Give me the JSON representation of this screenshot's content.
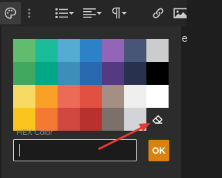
{
  "toolbar": {
    "items": [
      {
        "name": "palette-icon"
      },
      {
        "name": "more-vertical-icon"
      },
      {
        "name": "bulleted-list-icon",
        "has_dropdown": true
      },
      {
        "name": "align-left-icon",
        "has_dropdown": true
      },
      {
        "name": "paragraph-icon",
        "has_dropdown": true
      },
      {
        "name": "link-icon"
      },
      {
        "name": "image-icon"
      }
    ]
  },
  "palette": {
    "swatches": [
      [
        "#61bd6d",
        "#1abc9c",
        "#54acd2",
        "#2c82c9",
        "#9365b8",
        "#475577",
        "#cccccc"
      ],
      [
        "#41a85f",
        "#00a885",
        "#3d8eb9",
        "#2969b0",
        "#553982",
        "#28324e",
        "#000000"
      ],
      [
        "#f7da64",
        "#fba026",
        "#eb6b56",
        "#e25041",
        "#a38f84",
        "#efefef",
        "#ffffff"
      ],
      [
        "#fac51c",
        "#f37934",
        "#d14841",
        "#b8312f",
        "#7c706b",
        "#d1d5d8",
        "#2c2c2c"
      ]
    ],
    "clear_color_icon": "eraser-icon"
  },
  "hex": {
    "label": "HEX Color",
    "value": "",
    "placeholder": ""
  },
  "ok_button": {
    "label": "OK",
    "color": "#d9820f"
  },
  "peek_text": "e",
  "annotation": {
    "arrow_color": "#e53935"
  }
}
